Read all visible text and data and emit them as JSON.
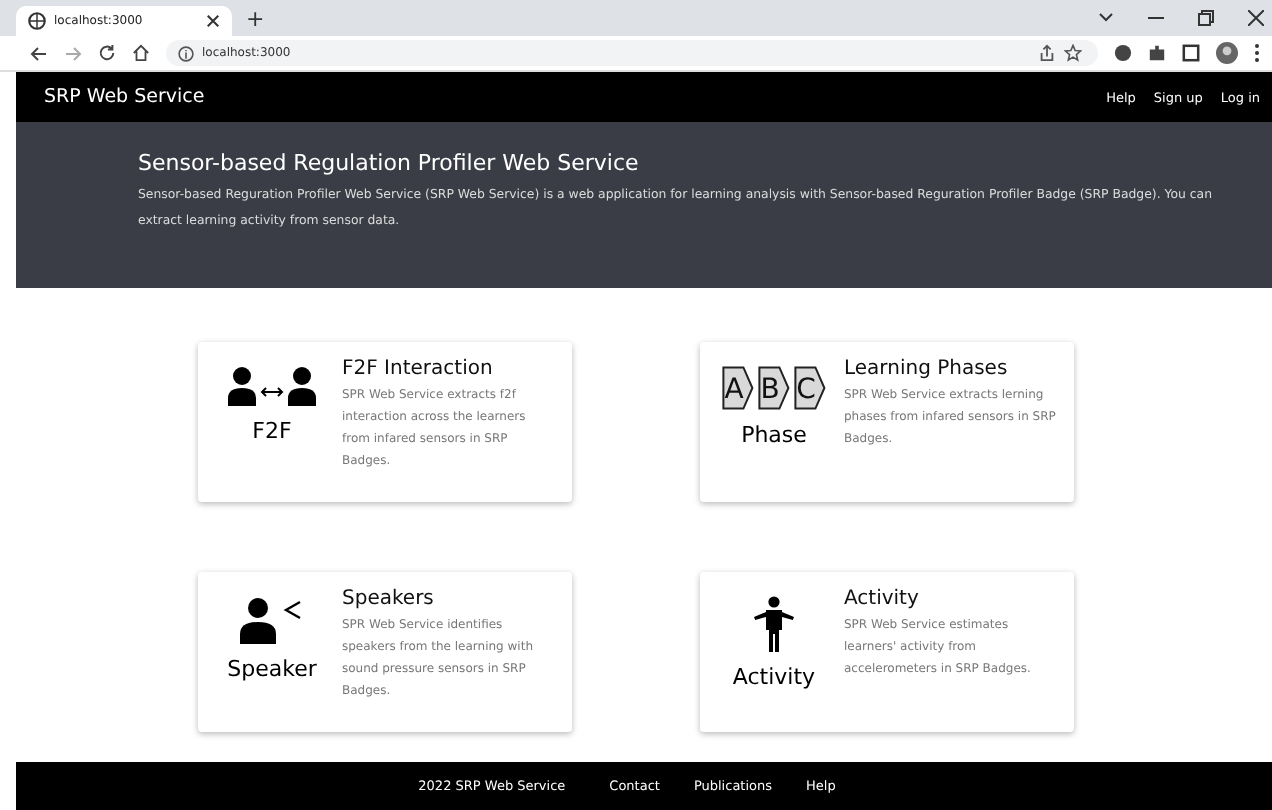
{
  "browser": {
    "tab_title": "localhost:3000",
    "new_tab": "+",
    "address": "localhost:3000"
  },
  "navbar": {
    "brand": "SRP Web Service",
    "links": [
      "Help",
      "Sign up",
      "Log in"
    ]
  },
  "hero": {
    "title": "Sensor-based Regulation Profiler Web Service",
    "text": "Sensor-based Reguration Profiler Web Service (SRP Web Service) is a web application for learning analysis with Sensor-based Reguration Profiler Badge (SRP Badge). You can extract learning activity from sensor data."
  },
  "cards": [
    {
      "kind": "f2f",
      "caption": "F2F",
      "title": "F2F Interaction",
      "text": "SPR Web Service extracts f2f interaction across the learners from infared sensors in SRP Badges."
    },
    {
      "kind": "phase",
      "letters": [
        "A",
        "B",
        "C"
      ],
      "caption": "Phase",
      "title": "Learning Phases",
      "text": "SPR Web Service extracts lerning phases from infared sensors in SRP Badges."
    },
    {
      "kind": "speaker",
      "caption": "Speaker",
      "title": "Speakers",
      "text": "SPR Web Service identifies speakers from the learning with sound pressure sensors in SRP Badges."
    },
    {
      "kind": "activity",
      "caption": "Activity",
      "title": "Activity",
      "text": "SPR Web Service estimates learners' activity from accelerometers in SRP Badges."
    }
  ],
  "footer": {
    "copyright": "2022 SRP Web Service",
    "links": [
      "Contact",
      "Publications",
      "Help"
    ]
  }
}
